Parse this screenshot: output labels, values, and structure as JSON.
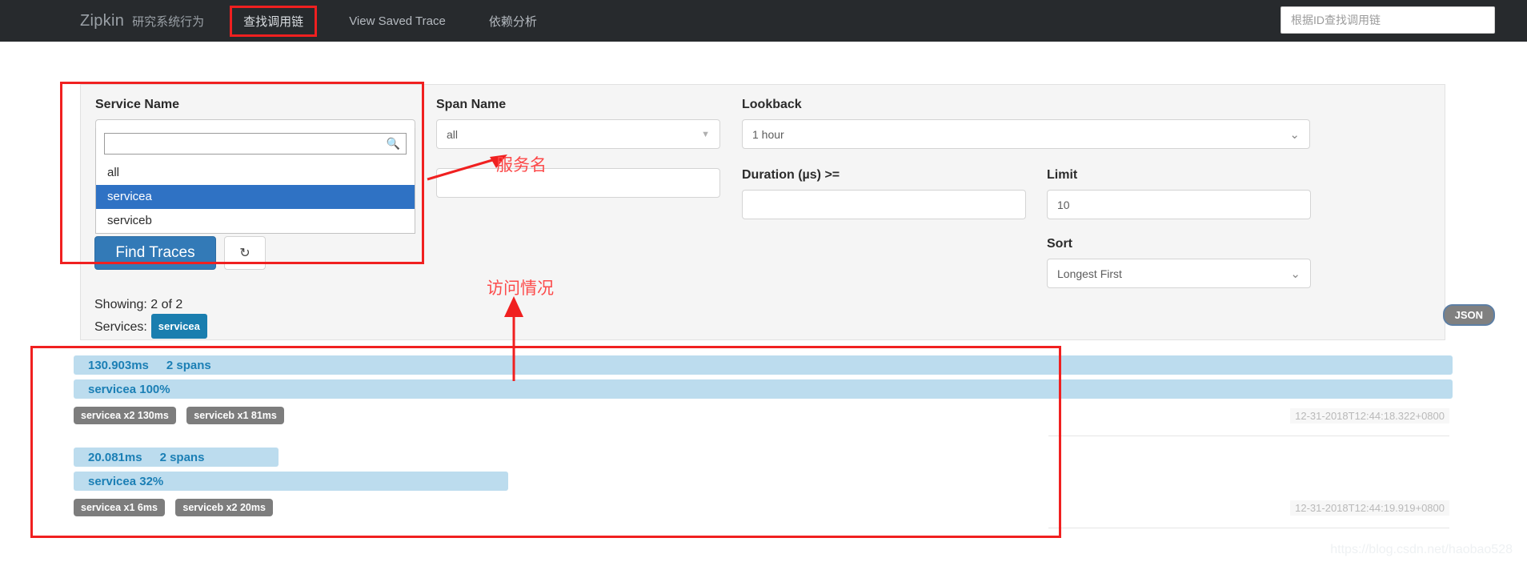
{
  "navbar": {
    "brand": "Zipkin",
    "brand_sub": "研究系统行为",
    "items": [
      {
        "label": "查找调用链",
        "active": true
      },
      {
        "label": "View Saved Trace",
        "active": false
      },
      {
        "label": "依赖分析",
        "active": false
      }
    ],
    "search_placeholder": "根据ID查找调用链"
  },
  "search_panel": {
    "service_name": {
      "label": "Service Name",
      "value": "servicea",
      "filter_value": "",
      "options": [
        "all",
        "servicea",
        "serviceb"
      ],
      "selected_option": "servicea"
    },
    "span_name": {
      "label": "Span Name",
      "value": "all"
    },
    "annotation": {
      "label": "",
      "value": ""
    },
    "lookback": {
      "label": "Lookback",
      "value": "1 hour"
    },
    "duration": {
      "label": "Duration (µs) >=",
      "value": ""
    },
    "limit": {
      "label": "Limit",
      "value": "10"
    },
    "sort": {
      "label": "Sort",
      "value": "Longest First"
    },
    "find_traces_label": "Find Traces",
    "refresh_icon": "refresh-icon"
  },
  "results_header": {
    "showing": "Showing: 2 of 2",
    "services_label": "Services:",
    "services_badges": [
      "servicea"
    ],
    "json_label": "JSON"
  },
  "traces": [
    {
      "duration": "130.903ms",
      "spans": "2 spans",
      "service_percent": "servicea 100%",
      "bar_width_pct": 100,
      "service_bar_width_pct": 100,
      "pills": [
        "servicea x2 130ms",
        "serviceb x1 81ms"
      ],
      "timestamp": "12-31-2018T12:44:18.322+0800"
    },
    {
      "duration": "20.081ms",
      "spans": "2 spans",
      "service_percent": "servicea 32%",
      "bar_width_pct": 15,
      "service_bar_width_pct": 32,
      "pills": [
        "servicea x1 6ms",
        "serviceb x2 20ms"
      ],
      "timestamp": "12-31-2018T12:44:19.919+0800"
    }
  ],
  "annotations": [
    {
      "text": "服务名"
    },
    {
      "text": "访问情况"
    }
  ],
  "watermark": "https://blog.csdn.net/haobao528",
  "colors": {
    "navbar_bg": "#272a2d",
    "accent_blue": "#337ab7",
    "bar_blue": "#bcdcee",
    "bar_text": "#1b7fb5",
    "badge_blue": "#1a7eaf",
    "pill_gray": "#7d7d7d",
    "annotation_red": "#f02020",
    "dropdown_selected": "#2f72c4"
  }
}
